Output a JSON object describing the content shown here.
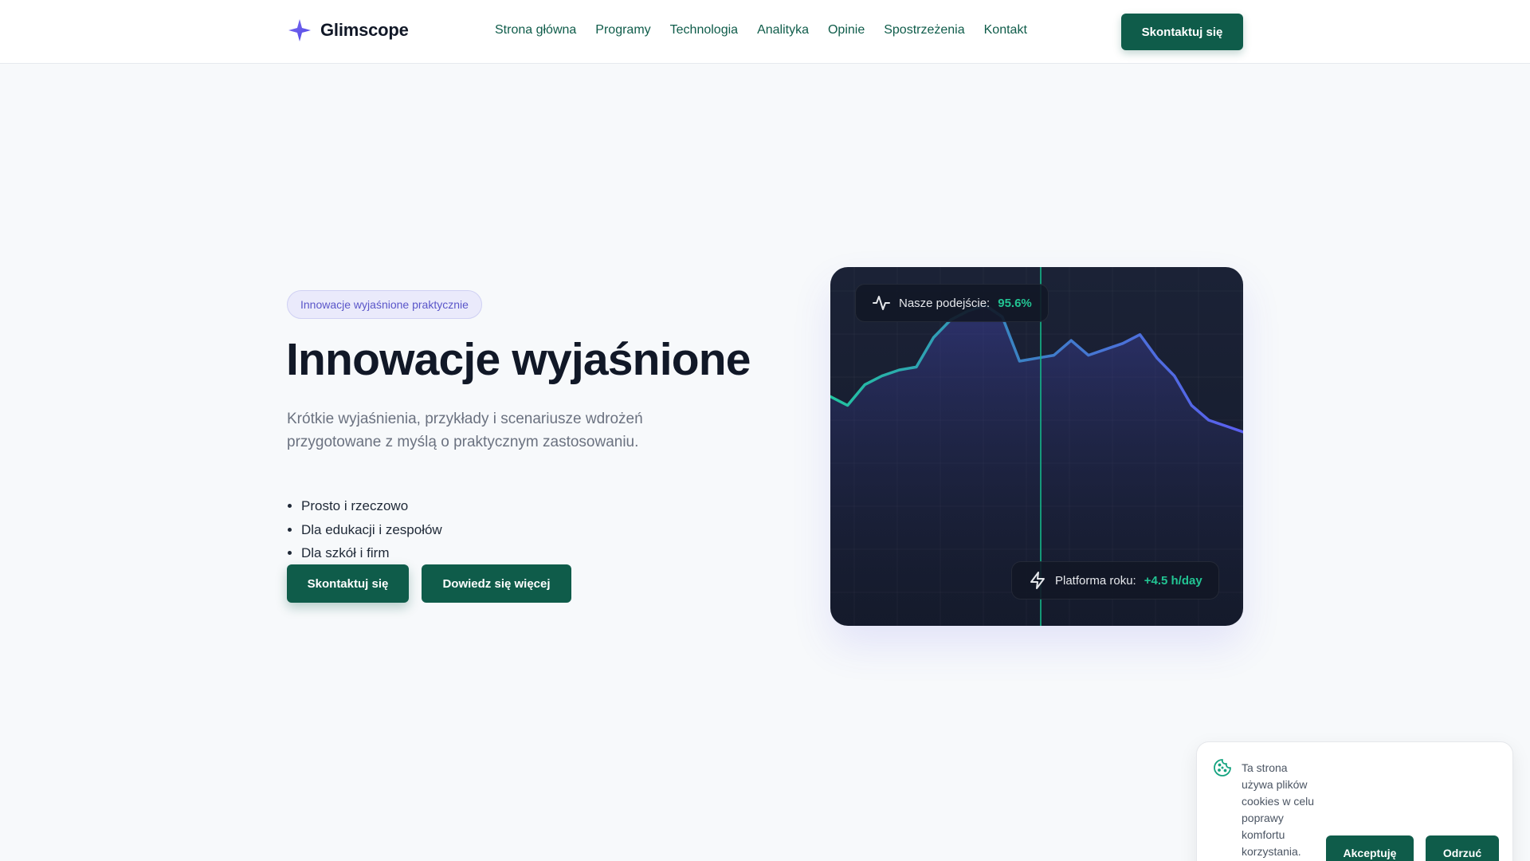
{
  "brand": {
    "name": "Glimscope"
  },
  "nav": {
    "items": [
      "Strona główna",
      "Programy",
      "Technologia",
      "Analityka",
      "Opinie",
      "Spostrzeżenia",
      "Kontakt"
    ],
    "cta": "Skontaktuj się"
  },
  "hero": {
    "badge": "Innowacje wyjaśnione praktycznie",
    "title": "Innowacje wyjaśnione",
    "subtitle": "Krótkie wyjaśnienia, przykłady i scenariusze wdrożeń przygotowane z myślą o praktycznym zastosowaniu.",
    "bullets": [
      "Prosto i rzeczowo",
      "Dla edukacji i zespołów",
      "Dla szkół i firm"
    ],
    "primary_button": "Skontaktuj się",
    "secondary_button": "Dowiedz się więcej"
  },
  "chart_card": {
    "top_pill": {
      "label": "Nasze podejście:",
      "value": "95.6%",
      "icon": "pulse-icon"
    },
    "bottom_pill": {
      "label": "Platforma roku:",
      "value": "+4.5 h/day",
      "icon": "lightning-icon"
    }
  },
  "chart_data": {
    "type": "area",
    "title": "",
    "xlabel": "",
    "ylabel": "",
    "x": [
      0,
      1,
      2,
      3,
      4,
      5,
      6,
      7,
      8,
      9,
      10,
      11,
      12,
      13,
      14,
      15,
      16,
      17,
      18,
      19,
      20,
      21,
      22,
      23,
      24
    ],
    "values": [
      48,
      45,
      52,
      55,
      57,
      58,
      68,
      74,
      77,
      79,
      75,
      60,
      61,
      62,
      67,
      62,
      64,
      66,
      69,
      61,
      55,
      45,
      40,
      38,
      36
    ],
    "ylim": [
      0,
      100
    ],
    "grid": true,
    "colors": {
      "line_start": "#22c4a0",
      "line_end": "#5b5ff0",
      "marker": "#14b88a"
    }
  },
  "cookie": {
    "text": "Ta strona używa plików cookies w celu poprawy komfortu korzystania.",
    "accept": "Akceptuję",
    "reject": "Odrzuć"
  }
}
